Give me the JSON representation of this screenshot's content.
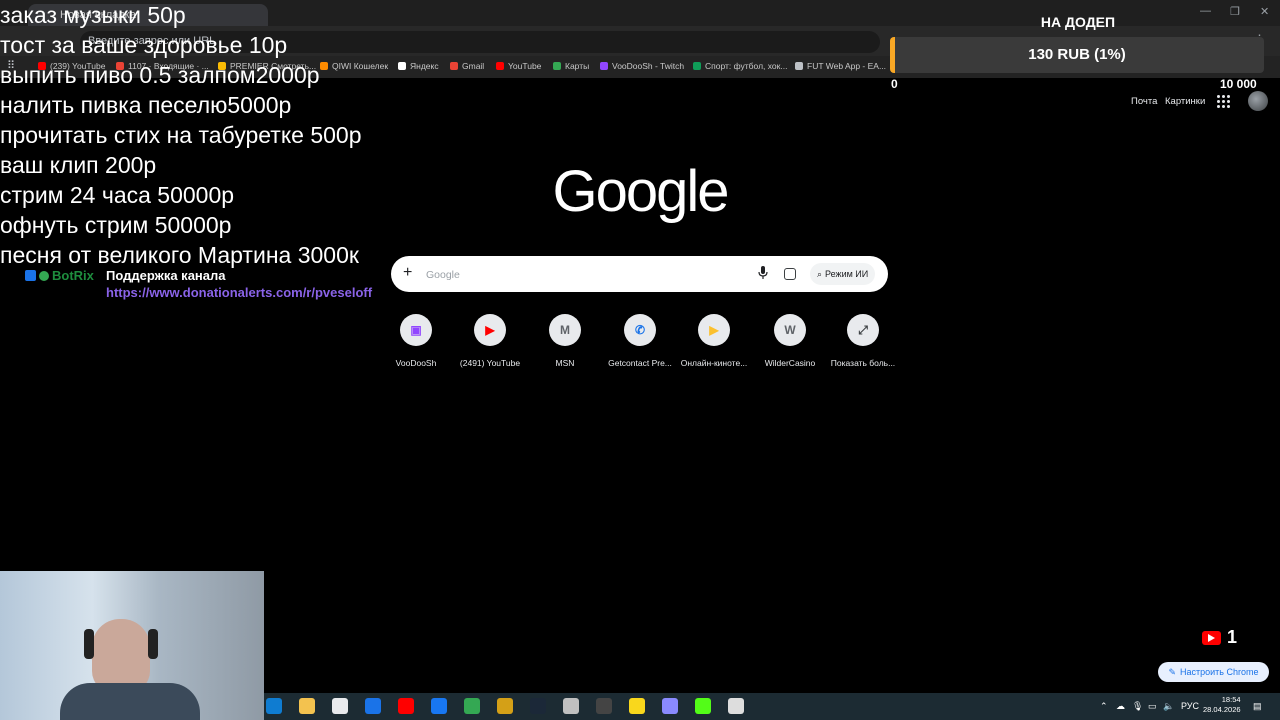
{
  "browser": {
    "tab_title": "Новая вкладка",
    "omnibox_text": "Введите запрос или URL",
    "window_min": "—",
    "window_max": "❐",
    "window_close": "✕",
    "bookmarks": [
      {
        "label": "(239) YouTube",
        "color": "#ff0000"
      },
      {
        "label": "1107 · Входящие · ...",
        "color": "#ea4335"
      },
      {
        "label": "PREMIER Смотреть...",
        "color": "#fbbc04"
      },
      {
        "label": "QIWI Кошелек",
        "color": "#ff8c00"
      },
      {
        "label": "Яндекс",
        "color": "#ffffff"
      },
      {
        "label": "Gmail",
        "color": "#ea4335"
      },
      {
        "label": "YouTube",
        "color": "#ff0000"
      },
      {
        "label": "Карты",
        "color": "#34a853"
      },
      {
        "label": "VooDooSh - Twitch",
        "color": "#9146ff"
      },
      {
        "label": "Спорт: футбол, хок...",
        "color": "#0f9d58"
      },
      {
        "label": "FUT Web App - EA...",
        "color": "#bdc1c6"
      }
    ]
  },
  "google": {
    "logo": "Google",
    "top_links": [
      "Почта",
      "Картинки"
    ],
    "search_placeholder": "Google",
    "ai_mode": "Режим ИИ",
    "shortcuts": [
      {
        "label": "VooDooSh",
        "icon": "twitch-icon",
        "color": "#9146ff"
      },
      {
        "label": "(2491) YouTube",
        "icon": "youtube-icon",
        "color": "#ff0000"
      },
      {
        "label": "MSN",
        "icon": "letter-m-icon",
        "color": "#5f6368"
      },
      {
        "label": "Getcontact Pre...",
        "icon": "phone-icon",
        "color": "#1a73e8"
      },
      {
        "label": "Онлайн-киноте...",
        "icon": "play-icon",
        "color": "#fbc02d"
      },
      {
        "label": "WilderCasino",
        "icon": "letter-w-icon",
        "color": "#5f6368"
      },
      {
        "label": "Показать боль...",
        "icon": "expand-icon",
        "color": "#3c4043"
      }
    ],
    "customize_label": "Настроить Chrome"
  },
  "overlay": {
    "menu_lines": [
      "заказ музыки 50р",
      "тост за ваше здоровье 10р",
      "выпить пиво 0.5 залпом2000р",
      "налить пивка песелю5000р",
      "прочитать стих на табуретке 500р",
      "ваш клип 200р",
      "стрим 24 часа 50000р",
      "офнуть стрим 50000р",
      "песня от великого Мартина 3000к"
    ],
    "botrix": {
      "name": "BotRix",
      "title": "Поддержка канала",
      "url": "https://www.donationalerts.com/r/pveseloff"
    },
    "goal": {
      "title": "НА ДОДЕП",
      "progress_text": "130 RUB (1%)",
      "progress_fraction": 0.013,
      "min": "0",
      "max": "10 000",
      "fill_color": "#f9a825"
    },
    "youtube_viewers": "1"
  },
  "taskbar": {
    "icons": [
      {
        "name": "edge-icon",
        "color": "#0f7cd1"
      },
      {
        "name": "explorer-icon",
        "color": "#f3c24f"
      },
      {
        "name": "store-icon",
        "color": "#e8eaed"
      },
      {
        "name": "mail-icon",
        "color": "#1a73e8"
      },
      {
        "name": "youtube-icon",
        "color": "#ff0000"
      },
      {
        "name": "facebook-icon",
        "color": "#1877f2"
      },
      {
        "name": "chrome-icon",
        "color": "#34a853"
      },
      {
        "name": "winamp-icon",
        "color": "#d4a017"
      },
      {
        "name": "steam-icon",
        "color": "#1b2838"
      },
      {
        "name": "settings-icon",
        "color": "#c0c0c0"
      },
      {
        "name": "terminal-icon",
        "color": "#444444"
      },
      {
        "name": "bars-icon",
        "color": "#f9d71c"
      },
      {
        "name": "obs-icon",
        "color": "#8a8aff"
      },
      {
        "name": "kick-icon",
        "color": "#53fc18"
      },
      {
        "name": "chrome-alt-icon",
        "color": "#dddddd"
      }
    ],
    "lang": "РУС",
    "time": "18:54",
    "date": "28.04.2026"
  }
}
